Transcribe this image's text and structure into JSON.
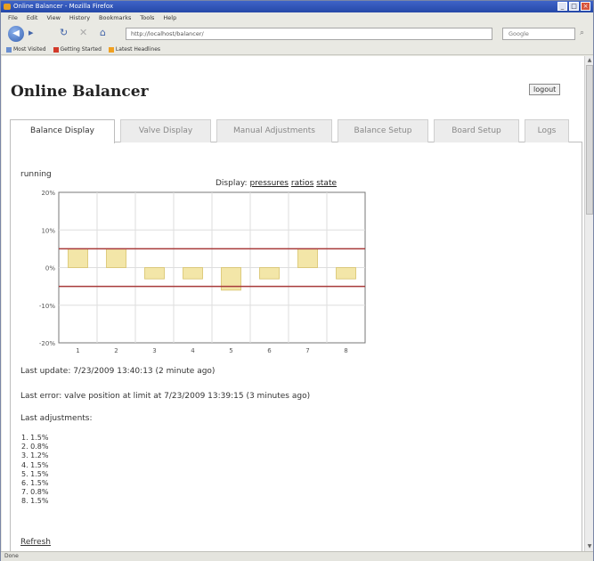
{
  "window": {
    "title": "Online Balancer - Mozilla Firefox",
    "controls": [
      "_",
      "□",
      "×"
    ]
  },
  "menubar": {
    "items": [
      "File",
      "Edit",
      "View",
      "History",
      "Bookmarks",
      "Tools",
      "Help"
    ]
  },
  "navbar": {
    "url": "http://localhost/balancer/",
    "search_placeholder": "Google"
  },
  "bookmarks": {
    "items": [
      "Most Visited",
      "Getting Started",
      "Latest Headlines"
    ]
  },
  "page": {
    "title": "Online Balancer",
    "logout_label": "logout",
    "tabs": [
      "Balance Display",
      "Valve Display",
      "Manual Adjustments",
      "Balance Setup",
      "Board Setup",
      "Logs"
    ],
    "active_tab": 0,
    "state_text": "running",
    "display_label": "Display:",
    "display_links": [
      "pressures",
      "ratios",
      "state"
    ],
    "last_update": "Last update: 7/23/2009 13:40:13 (2 minute ago)",
    "last_error": "Last error: valve position at limit at 7/23/2009 13:39:15 (3 minutes ago)",
    "last_adjustments_label": "Last adjustments:",
    "adjustments": [
      "1. 1.5%",
      "2. 0.8%",
      "3. 1.2%",
      "4. 1.5%",
      "5. 1.5%",
      "6. 1.5%",
      "7. 0.8%",
      "8. 1.5%"
    ],
    "refresh_label": "Refresh"
  },
  "statusbar": {
    "text": "Done"
  },
  "chart_data": {
    "type": "bar",
    "categories": [
      "1",
      "2",
      "3",
      "4",
      "5",
      "6",
      "7",
      "8"
    ],
    "values": [
      5,
      5,
      -3,
      -3,
      -6,
      -3,
      5,
      -3
    ],
    "y_ticks": [
      "20%",
      "10%",
      "0%",
      "-10%",
      "-20%"
    ],
    "ylim": [
      -20,
      20
    ],
    "limit_lines": [
      5,
      -5
    ],
    "grid": true,
    "colors": {
      "bar_fill": "#f3e6a8",
      "bar_stroke": "#d8c26a",
      "limit_line": "#a83a3a",
      "grid": "#dedede",
      "frame": "#777777"
    }
  }
}
